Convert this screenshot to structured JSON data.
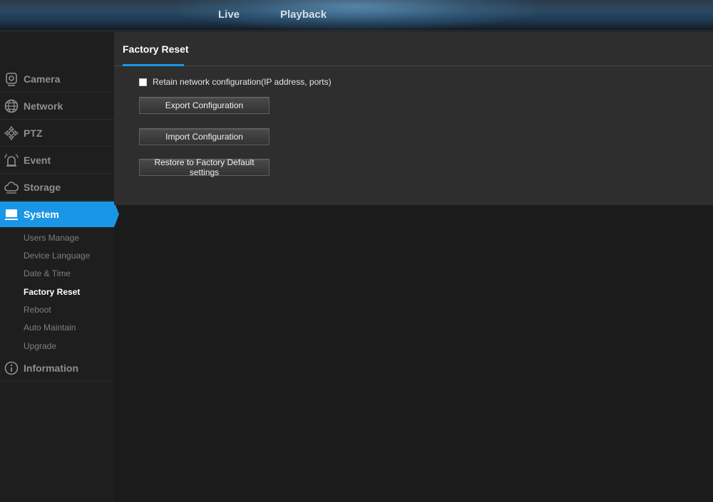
{
  "topnav": {
    "live": "Live",
    "playback": "Playback"
  },
  "sidebar": {
    "items": [
      {
        "label": "Camera",
        "icon": "camera-icon"
      },
      {
        "label": "Network",
        "icon": "globe-icon"
      },
      {
        "label": "PTZ",
        "icon": "ptz-directions-icon"
      },
      {
        "label": "Event",
        "icon": "alarm-icon"
      },
      {
        "label": "Storage",
        "icon": "cloud-icon"
      },
      {
        "label": "System",
        "icon": "monitor-icon",
        "active": true
      },
      {
        "label": "Information",
        "icon": "info-icon"
      }
    ],
    "system_sub": [
      {
        "label": "Users Manage"
      },
      {
        "label": "Device Language"
      },
      {
        "label": "Date & Time"
      },
      {
        "label": "Factory Reset",
        "active": true
      },
      {
        "label": "Reboot"
      },
      {
        "label": "Auto Maintain"
      },
      {
        "label": "Upgrade"
      }
    ]
  },
  "panel": {
    "title": "Factory Reset",
    "retain_label": "Retain network configuration(IP address, ports)",
    "retain_checked": false,
    "export_label": "Export Configuration",
    "import_label": "Import Configuration",
    "restore_label": "Restore to Factory Default settings"
  },
  "colors": {
    "accent": "#1a96e6",
    "background": "#1b1b1b",
    "panel": "#2e2e2e"
  }
}
